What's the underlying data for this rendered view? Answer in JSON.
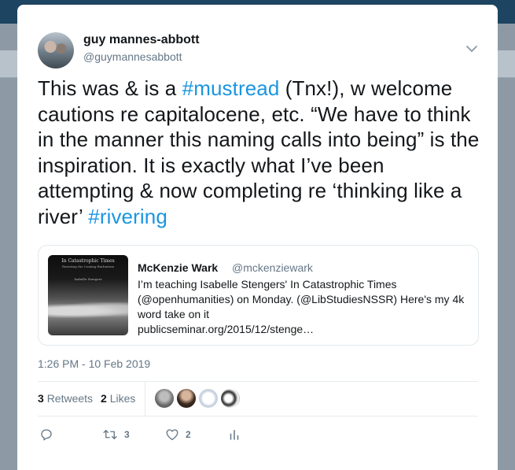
{
  "author": {
    "name": "guy mannes-abbott",
    "handle": "@guymannesabbott"
  },
  "tweet": {
    "segments": [
      {
        "text": "This was & is a ",
        "tag": false
      },
      {
        "text": "#mustread",
        "tag": true
      },
      {
        "text": " (Tnx!), w welcome cautions re capitalocene, etc. “We have to think in the manner this naming calls into being” is the inspiration. It is exactly what I’ve been attempting & now completing re ‘thinking like a river’ ",
        "tag": false
      },
      {
        "text": "#rivering",
        "tag": true
      }
    ]
  },
  "quoted_tweet": {
    "name": "McKenzie Wark",
    "handle": "@mckenziewark",
    "text_line1": "I’m teaching Isabelle Stengers' In Catastrophic Times",
    "text_line2": "(@openhumanities) on Monday. (@LibStudiesNSSR) Here's my 4k",
    "text_line3": "word take on it",
    "link": "publicseminar.org/2015/12/stenge…",
    "image": {
      "title": "In Catastrophic Times",
      "subtitle": "Resisting the Coming Barbarism",
      "author": "Isabelle Stengers"
    }
  },
  "timestamp": "1:26 PM - 10 Feb 2019",
  "stats": {
    "retweets_count": "3",
    "retweets_label": "Retweets",
    "likes_count": "2",
    "likes_label": "Likes"
  },
  "actions": {
    "reply_count": "",
    "retweet_count": "3",
    "like_count": "2"
  },
  "colors": {
    "hashtag": "#1b95e0",
    "secondary_text": "#657786",
    "primary_text": "#14171a"
  },
  "icons": [
    "chevron-down-icon",
    "reply-icon",
    "retweet-icon",
    "heart-icon",
    "analytics-icon"
  ]
}
